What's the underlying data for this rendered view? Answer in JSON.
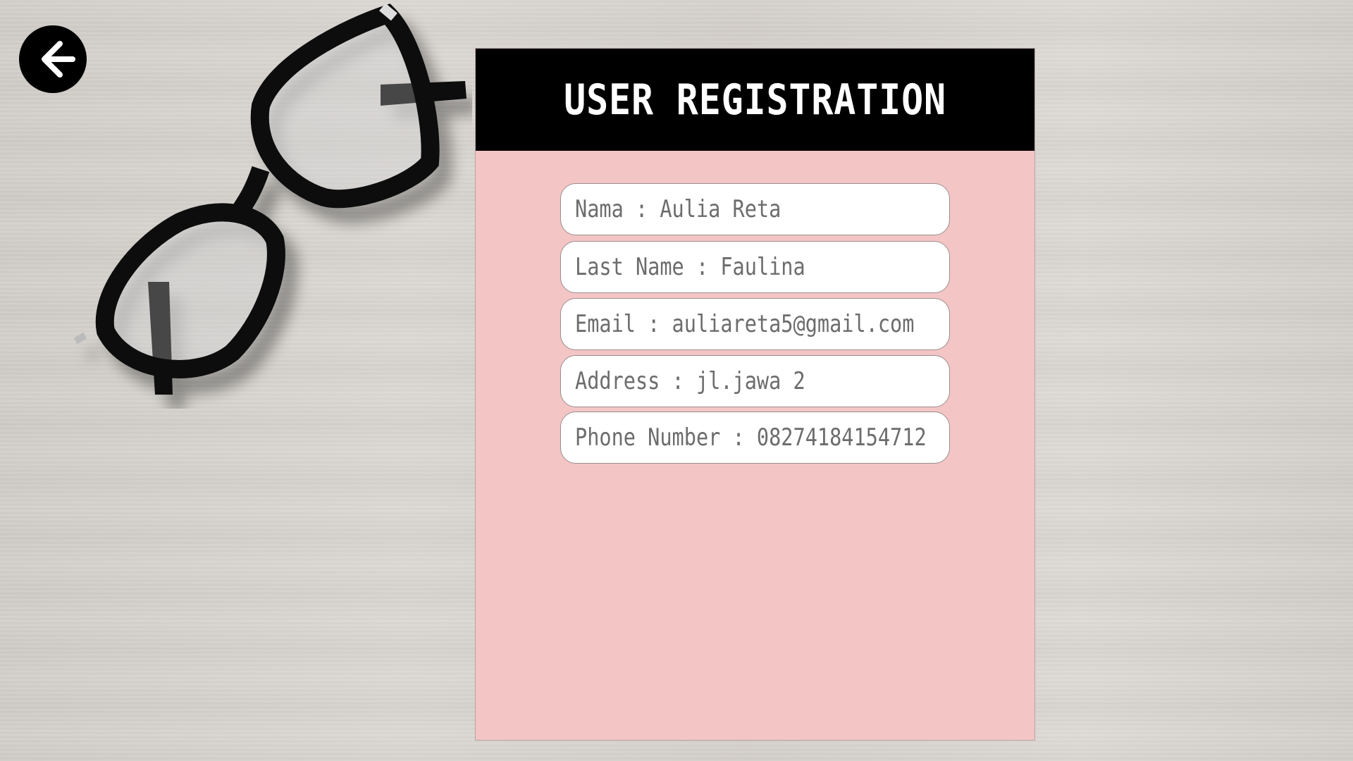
{
  "header": {
    "title": "USER REGISTRATION"
  },
  "navigation": {
    "back_icon": "arrow-left-icon"
  },
  "form": {
    "fields": [
      {
        "label": "Nama",
        "value": "Aulia Reta",
        "text": "Nama : Aulia Reta"
      },
      {
        "label": "Last Name",
        "value": "Faulina",
        "text": "Last Name : Faulina"
      },
      {
        "label": "Email",
        "value": "auliareta5@gmail.com",
        "text": "Email : auliareta5@gmail.com"
      },
      {
        "label": "Address",
        "value": "jl.jawa 2",
        "text": "Address : jl.jawa 2"
      },
      {
        "label": "Phone Number",
        "value": "08274184154712",
        "text": "Phone Number : 08274184154712"
      }
    ]
  },
  "colors": {
    "card_background": "#f4c5c5",
    "header_background": "#000000",
    "header_text": "#ffffff",
    "field_background": "#ffffff",
    "field_text": "#6c6c6c"
  }
}
